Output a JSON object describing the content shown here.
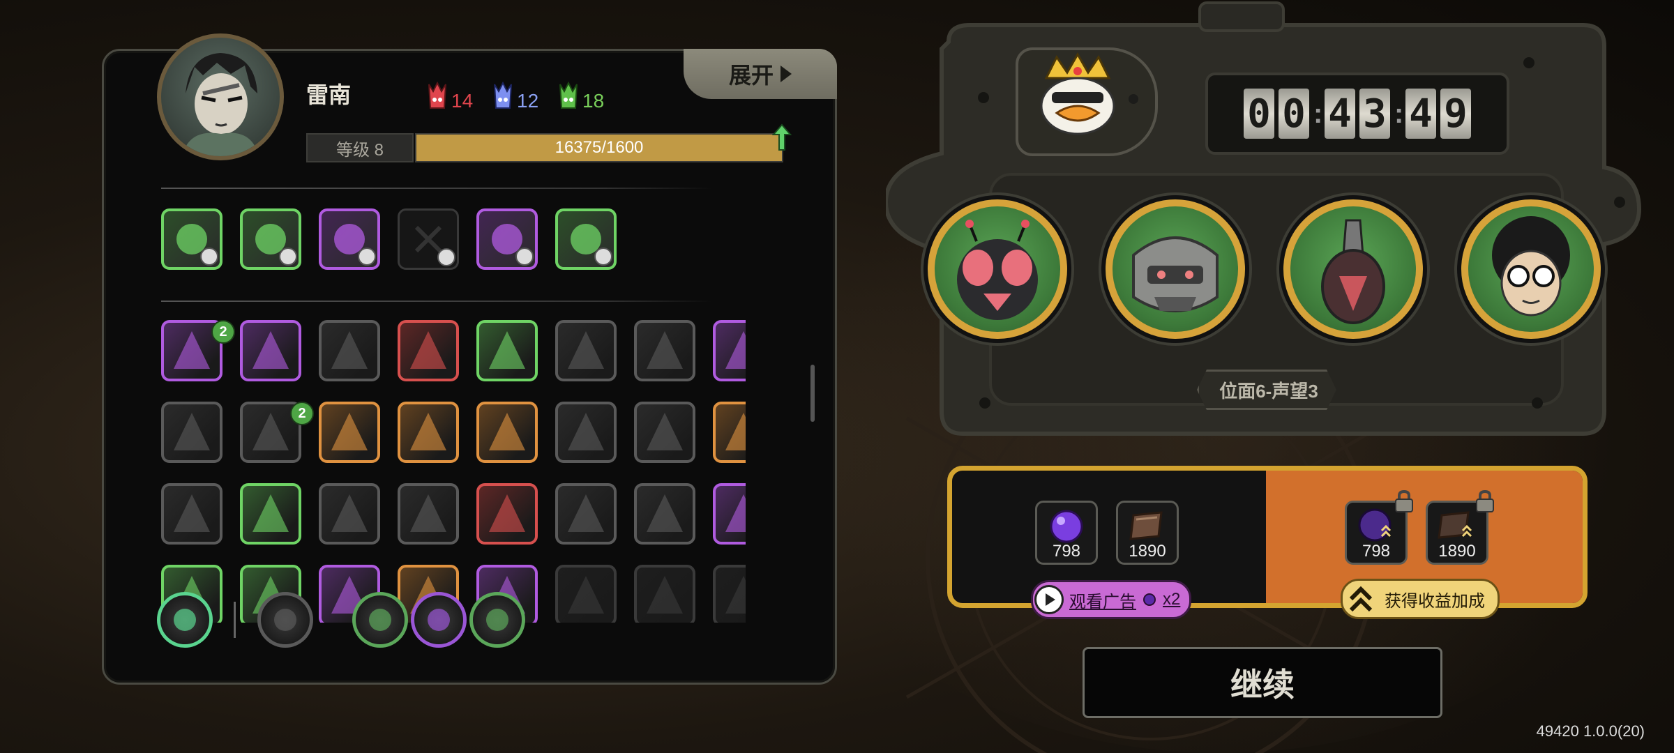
{
  "player": {
    "name": "雷南",
    "resources": [
      {
        "icon": "red-crystal-icon",
        "value": "14",
        "color": "#e0454d"
      },
      {
        "icon": "blue-crystal-icon",
        "value": "12",
        "color": "#8aa0f2"
      },
      {
        "icon": "green-crystal-icon",
        "value": "18",
        "color": "#79cf5a"
      }
    ],
    "level_label": "等级 8",
    "xp_text": "16375/1600",
    "expand_label": "展开"
  },
  "equipment_slots": [
    {
      "icon": "claw-strike-icon",
      "border": "#6fd465"
    },
    {
      "icon": "ring-disc-icon",
      "border": "#6fd465"
    },
    {
      "icon": "mouse-face-icon",
      "border": "#b05be0"
    },
    {
      "icon": "empty-slot-icon",
      "border": "#3a3a3a"
    },
    {
      "icon": "armor-plate-icon",
      "border": "#b05be0"
    },
    {
      "icon": "leaf-burst-icon",
      "border": "#6fd465"
    }
  ],
  "skills": [
    {
      "icon": "fortress-icon",
      "border": "#b05be0",
      "count": "2"
    },
    {
      "icon": "purple-ghost-icon",
      "border": "#b05be0"
    },
    {
      "icon": "sunrise-icon",
      "border": "#5a5a5a"
    },
    {
      "icon": "red-boots-icon",
      "border": "#d7504e"
    },
    {
      "icon": "crossed-blades-icon",
      "border": "#6fd465"
    },
    {
      "icon": "green-diamond-icon",
      "border": "#5a5a5a"
    },
    {
      "icon": "pink-petal-icon",
      "border": "#5a5a5a"
    },
    {
      "icon": "purple-splash-icon",
      "border": "#b05be0"
    },
    {
      "icon": "golden-burst-icon",
      "border": "#5a5a5a"
    },
    {
      "icon": "dolphin-icon",
      "border": "#5a5a5a",
      "count": "2"
    },
    {
      "icon": "red-tooth-icon",
      "border": "#e09240"
    },
    {
      "icon": "red-lightning-icon",
      "border": "#e09240"
    },
    {
      "icon": "green-shield-icon",
      "border": "#e09240"
    },
    {
      "icon": "green-wave-icon",
      "border": "#5a5a5a"
    },
    {
      "icon": "blue-lightning-icon",
      "border": "#5a5a5a"
    },
    {
      "icon": "purple-eye-icon",
      "border": "#e09240"
    },
    {
      "icon": "red-stripes-icon",
      "border": "#5a5a5a"
    },
    {
      "icon": "purple-cracks-icon",
      "border": "#6fd465"
    },
    {
      "icon": "fire-face-icon",
      "border": "#5a5a5a"
    },
    {
      "icon": "gold-chain-icon",
      "border": "#5a5a5a"
    },
    {
      "icon": "masked-face-icon",
      "border": "#d7504e"
    },
    {
      "icon": "green-grass-icon",
      "border": "#5a5a5a"
    },
    {
      "icon": "blue-eye-icon",
      "border": "#5a5a5a"
    },
    {
      "icon": "pink-hand-icon",
      "border": "#b05be0"
    },
    {
      "icon": "skill-row4-1-icon",
      "border": "#6fd465"
    },
    {
      "icon": "skill-row4-2-icon",
      "border": "#6fd465"
    },
    {
      "icon": "skill-row4-3-icon",
      "border": "#b05be0"
    },
    {
      "icon": "skill-row4-4-icon",
      "border": "#e09240"
    },
    {
      "icon": "skill-row4-5-icon",
      "border": "#b05be0"
    },
    {
      "icon": "skill-row4-6-icon",
      "border": "#3a3a3a"
    },
    {
      "icon": "skill-row4-7-icon",
      "border": "#3a3a3a"
    },
    {
      "icon": "skill-row4-8-icon",
      "border": "#3a3a3a"
    }
  ],
  "active_skills": [
    {
      "icon": "purple-flame-icon",
      "border": "#5ad48f"
    },
    {
      "icon": "red-claw-icon",
      "border": "#5a5a5a"
    },
    {
      "icon": "triangle-rune-icon",
      "border": "#5ba75a"
    },
    {
      "icon": "heart-rune-icon",
      "border": "#9a56d6"
    },
    {
      "icon": "green-arrows-icon",
      "border": "#5ba75a"
    }
  ],
  "team": {
    "boss_icon": "crowned-duck-king-icon",
    "timer_digits": [
      "0",
      "0",
      "4",
      "3",
      "4",
      "9"
    ],
    "heroes": [
      {
        "icon": "red-bug-monster-icon"
      },
      {
        "icon": "armored-mech-icon"
      },
      {
        "icon": "dark-drill-creature-icon"
      },
      {
        "icon": "afro-glasses-hero-icon"
      }
    ],
    "position_label": "位面6-声望3"
  },
  "rewards": {
    "base": [
      {
        "icon": "purple-orb-icon",
        "value": "798"
      },
      {
        "icon": "brown-book-icon",
        "value": "1890"
      }
    ],
    "boosted": [
      {
        "icon": "purple-orb-boost-icon",
        "value": "798"
      },
      {
        "icon": "brown-book-boost-icon",
        "value": "1890"
      }
    ],
    "watch_ad_label": "观看广告",
    "watch_ad_multiplier": "x2",
    "boost_label": "获得收益加成"
  },
  "continue_label": "继续",
  "version": "49420 1.0.0(20)",
  "colors": {
    "gold": "#d4a430",
    "orange": "#d2702c",
    "panel": "#0b0b0b"
  }
}
